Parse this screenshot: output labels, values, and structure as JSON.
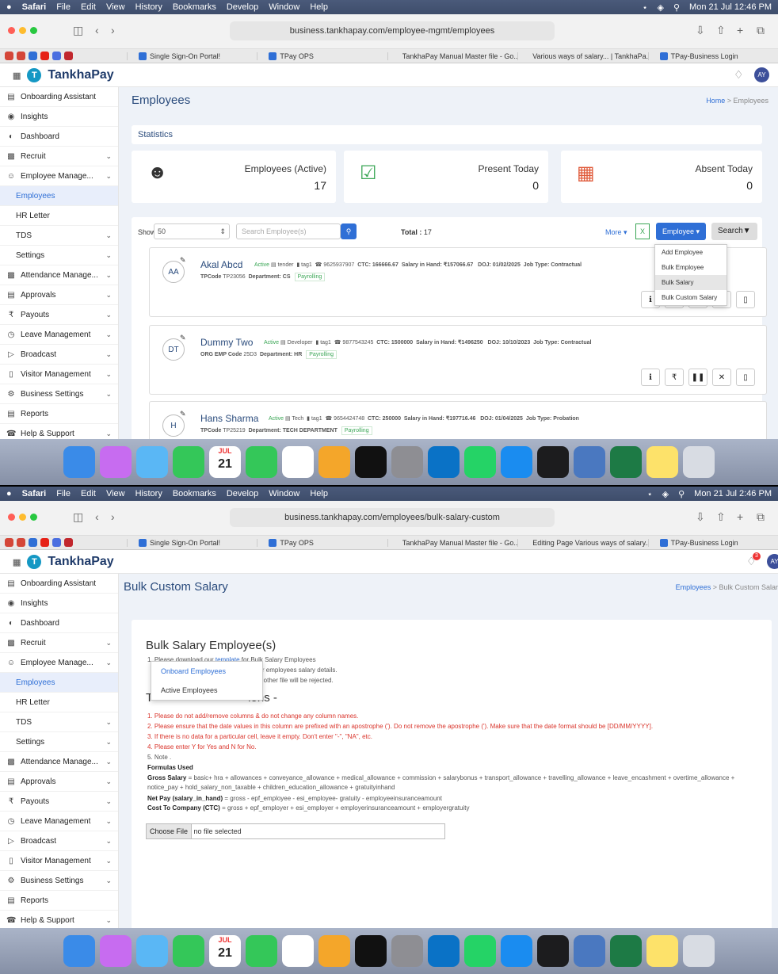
{
  "s1": {
    "menubar": {
      "apple": "",
      "items": [
        "Safari",
        "File",
        "Edit",
        "View",
        "History",
        "Bookmarks",
        "Develop",
        "Window",
        "Help"
      ],
      "clock": "Mon 21 Jul 12:46 PM"
    },
    "url": "business.tankhapay.com/employee-mgmt/employees",
    "tabs": [
      "Single Sign-On Portal!",
      "TPay OPS",
      "TankhaPay Manual Master file - Go...",
      "Various ways of salary... | TankhaPa...",
      "TPay-Business Login"
    ],
    "brand": "TankhaPay",
    "avatar": "AY",
    "sidebar": [
      "Onboarding Assistant",
      "Insights",
      "Dashboard",
      "Recruit",
      "Employee Manage...",
      "Employees",
      "HR Letter",
      "TDS",
      "Settings",
      "Attendance Manage...",
      "Approvals",
      "Payouts",
      "Leave Management",
      "Broadcast",
      "Visitor Management",
      "Business Settings",
      "Reports",
      "Help & Support"
    ],
    "page_title": "Employees",
    "crumb_home": "Home",
    "crumb_sep": " > ",
    "crumb_current": "Employees",
    "stats_title": "Statistics",
    "stat1_label": "Employees (Active)",
    "stat1_value": "17",
    "stat2_label": "Present Today",
    "stat2_value": "0",
    "stat3_label": "Absent Today",
    "stat3_value": "0",
    "show_label": "Show",
    "show_value": "50",
    "search_placeholder": "Search Employee(s)",
    "total_label": "Total :",
    "total_value": "17",
    "more": "More ▾",
    "employee_btn": "Employee ▾",
    "search_btn": "Search▼",
    "dropdown": [
      "Add Employee",
      "Bulk Employee",
      "Bulk Salary",
      "Bulk Custom Salary"
    ],
    "employees": [
      {
        "initials": "AA",
        "name": "Akal Abcd",
        "status": "Active",
        "designation": "tender",
        "tag": "tag1",
        "phone": "9625937907",
        "ctc": "CTC: 166666.67",
        "sih": "Salary in Hand: ₹157066.67",
        "doj": "DOJ: 01/02/2025",
        "job": "Job Type: Contractual",
        "code_label": "TPCode",
        "code": "TP23056",
        "dept": "Department: CS",
        "pay": "Payrolling"
      },
      {
        "initials": "DT",
        "name": "Dummy Two",
        "status": "Active",
        "designation": "Developer",
        "tag": "tag1",
        "phone": "9877543245",
        "ctc": "CTC: 1500000",
        "sih": "Salary in Hand: ₹1496250",
        "doj": "DOJ: 10/10/2023",
        "job": "Job Type: Contractual",
        "code_label": "ORG EMP Code",
        "code": "25D3",
        "dept": "Department: HR",
        "pay": "Payrolling"
      },
      {
        "initials": "H",
        "name": "Hans Sharma",
        "status": "Active",
        "designation": "Tech",
        "tag": "tag1",
        "phone": "9654424748",
        "ctc": "CTC: 250000",
        "sih": "Salary in Hand: ₹197716.46",
        "doj": "DOJ: 01/04/2025",
        "job": "Job Type: Probation",
        "code_label": "TPCode",
        "code": "TP25219",
        "dept": "Department: TECH DEPARTMENT",
        "pay": "Payrolling"
      }
    ],
    "dock_date": {
      "month": "JUL",
      "day": "21"
    }
  },
  "s2": {
    "clock": "Mon 21 Jul 2:46 PM",
    "url": "business.tankhapay.com/employees/bulk-salary-custom",
    "tabs": [
      "Single Sign-On Portal!",
      "TPay OPS",
      "TankhaPay Manual Master file - Go...",
      "Editing Page Various ways of salary...",
      "TPay-Business Login"
    ],
    "notif_count": "3",
    "page_title": "Bulk Custom Salary",
    "crumb_parent": "Employees",
    "crumb_sep": " > ",
    "crumb_current": "Bulk Custom Salar",
    "heading": "Bulk Salary Employee(s)",
    "line1_pre": "1. Please download our ",
    "line1_link": "template",
    "line1_post": " for Bulk Salary Employees",
    "line2": "our employees salary details.",
    "line3": "ny other file will be rejected.",
    "sub_heading_a": "T",
    "sub_heading_b": "ions -",
    "popup": [
      "Onboard Employees",
      "Active Employees"
    ],
    "rules": [
      "1. Please do not add/remove columns & do not change any column names.",
      "2. Please ensure that the date values in this column are prefixed with an apostrophe ('). Do not remove the apostrophe ('). Make sure that the date format should be [DD/MM/YYYY].",
      "3. If there is no data for a particular cell, leave it empty. Don't enter \"-\", \"NA\", etc.",
      "4. Please enter Y for Yes and N for No."
    ],
    "note": "5. Note .",
    "formulas_title": "Formulas Used",
    "gross_label": "Gross Salary",
    "gross": " = basic+ hra + allowances + conveyance_allowance + medical_allowance + commission + salarybonus + transport_allowance + travelling_allowance + leave_encashment + overtime_allowance + notice_pay + hold_salary_non_taxable + children_education_allowance + gratuityinhand",
    "net_label": "Net Pay (salary_in_hand)",
    "net": " = gross - epf_employee - esi_employee- gratuity - employeeinsuranceamount",
    "ctc_label": "Cost To Company (CTC)",
    "ctc": " = gross + epf_employer + esi_employer + employerinsuranceamount + employergratuity",
    "file_btn": "Choose File",
    "file_text": "no file selected"
  }
}
